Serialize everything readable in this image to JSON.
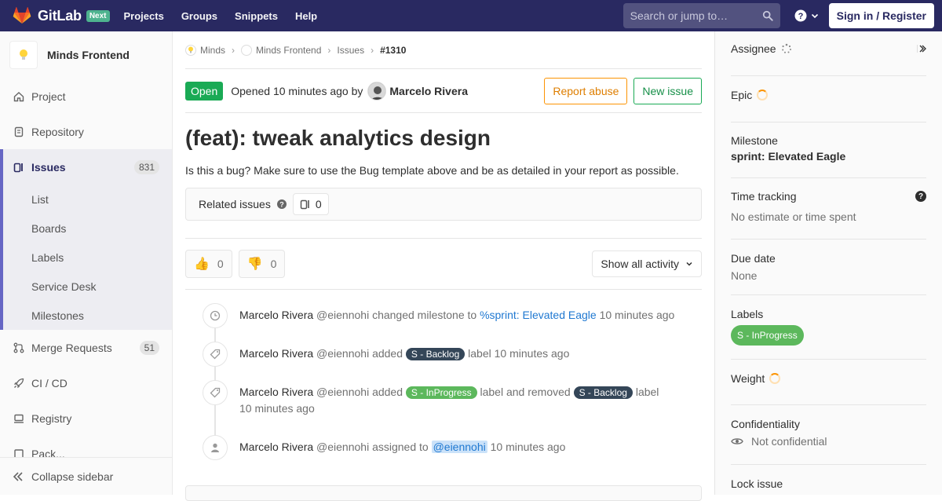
{
  "navbar": {
    "brand": "GitLab",
    "badge": "Next",
    "links": [
      "Projects",
      "Groups",
      "Snippets",
      "Help"
    ],
    "search_placeholder": "Search or jump to…",
    "signin": "Sign in / Register"
  },
  "sidebar": {
    "project_name": "Minds Frontend",
    "items": [
      {
        "label": "Project",
        "icon": "home-icon"
      },
      {
        "label": "Repository",
        "icon": "doc-icon"
      },
      {
        "label": "Issues",
        "icon": "issues-icon",
        "count": "831",
        "active": true
      },
      {
        "label": "Merge Requests",
        "icon": "merge-request-icon",
        "count": "51"
      },
      {
        "label": "CI / CD",
        "icon": "rocket-icon"
      },
      {
        "label": "Registry",
        "icon": "container-icon"
      },
      {
        "label": "Pack...",
        "icon": "package-icon"
      }
    ],
    "issue_subitems": [
      "List",
      "Boards",
      "Labels",
      "Service Desk",
      "Milestones"
    ],
    "collapse_label": "Collapse sidebar"
  },
  "breadcrumb": [
    "Minds",
    "Minds Frontend",
    "Issues",
    "#1310"
  ],
  "issue": {
    "status": "Open",
    "opened_text": "Opened 10 minutes ago by",
    "author": "Marcelo Rivera",
    "report_abuse": "Report abuse",
    "new_issue": "New issue",
    "title": "(feat): tweak analytics design",
    "description": "Is this a bug? Make sure to use the Bug template above and be as detailed in your report as possible.",
    "related_title": "Related issues",
    "related_count": "0",
    "thumbs_up": "0",
    "thumbs_down": "0",
    "activity_filter": "Show all activity"
  },
  "timeline": {
    "author": "Marcelo Rivera",
    "handle": "@eiennohi",
    "time": "10 minutes ago",
    "note1": {
      "pre": "changed milestone to",
      "link": "%sprint: Elevated Eagle"
    },
    "note2": {
      "pre": "added",
      "label": "S - Backlog",
      "post": "label"
    },
    "note3": {
      "pre": "added",
      "label_add": "S - InProgress",
      "mid": "label and removed",
      "label_remove": "S - Backlog",
      "post": "label"
    },
    "note4": {
      "pre": "assigned to",
      "mention": "@eiennohi"
    }
  },
  "right_sidebar": {
    "assignee": "Assignee",
    "epic": "Epic",
    "milestone": "Milestone",
    "milestone_value": "sprint: Elevated Eagle",
    "time_tracking": "Time tracking",
    "time_tracking_value": "No estimate or time spent",
    "due_date": "Due date",
    "due_date_value": "None",
    "labels": "Labels",
    "label_value": "S - InProgress",
    "weight": "Weight",
    "confidentiality": "Confidentiality",
    "confidentiality_value": "Not confidential",
    "lock_issue": "Lock issue"
  },
  "colors": {
    "navbar": "#292961",
    "open_green": "#1aaa55",
    "label_backlog": "#344658",
    "label_inprogress": "#5cb85c",
    "link_blue": "#1f78d1",
    "warning_orange": "#fc9403"
  }
}
